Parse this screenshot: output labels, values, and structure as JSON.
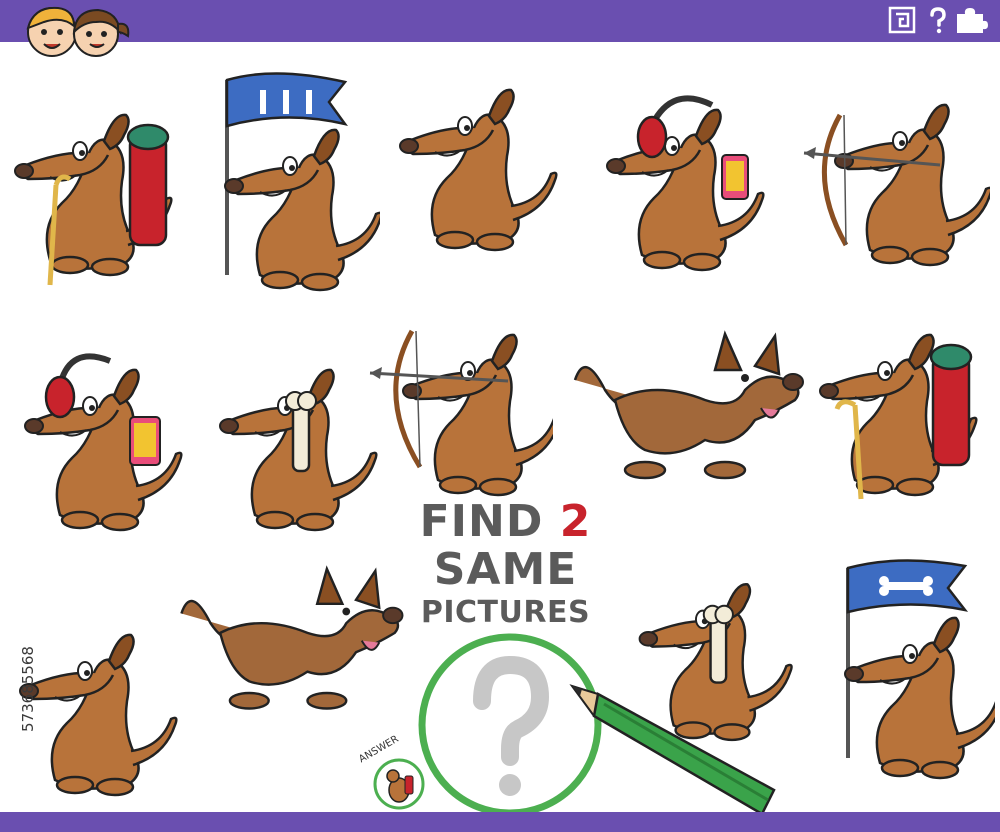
{
  "title": {
    "find": "FIND",
    "number": "2",
    "same": "SAME",
    "pictures": "PICTURES"
  },
  "answer_label": "ANSWER",
  "watermark": "573685568",
  "colors": {
    "bar": "#6a4fb0",
    "dog_fur": "#b8733a",
    "dog_dark": "#8a4f22",
    "accent_red": "#c8232c",
    "pencil_green": "#3aa34a",
    "magnifier_green": "#4caf50"
  },
  "toolbar_icons": [
    "maze-icon",
    "question-icon",
    "puzzle-icon"
  ],
  "dogs": [
    {
      "id": "dog-hiker-1",
      "props": "backpack-cane"
    },
    {
      "id": "dog-flag-1",
      "props": "flag-bones"
    },
    {
      "id": "dog-sitting-1",
      "props": "none"
    },
    {
      "id": "dog-headphones-1",
      "props": "headphones-phone"
    },
    {
      "id": "dog-archer-1",
      "props": "bow-arrow"
    },
    {
      "id": "dog-headphones-2",
      "props": "headphones-phone"
    },
    {
      "id": "dog-bone-1",
      "props": "bone"
    },
    {
      "id": "dog-archer-2",
      "props": "bow-arrow"
    },
    {
      "id": "dog-playful-1",
      "props": "none"
    },
    {
      "id": "dog-hiker-2",
      "props": "backpack-cane"
    },
    {
      "id": "dog-sitting-2",
      "props": "none"
    },
    {
      "id": "dog-playful-2",
      "props": "none"
    },
    {
      "id": "dog-bone-2",
      "props": "bone"
    },
    {
      "id": "dog-flag-2",
      "props": "flag-bone"
    }
  ]
}
